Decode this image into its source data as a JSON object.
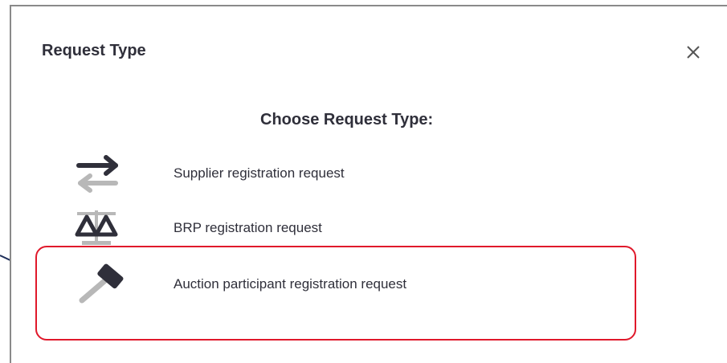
{
  "dialog": {
    "title": "Request Type",
    "close_icon": "close-icon",
    "heading": "Choose Request Type:"
  },
  "options": [
    {
      "label": "Supplier registration request",
      "icon": "swap-arrows-icon"
    },
    {
      "label": "BRP registration request",
      "icon": "balance-scale-icon"
    },
    {
      "label": "Auction participant registration request",
      "icon": "gavel-icon"
    }
  ],
  "colors": {
    "text": "#2f2f3a",
    "icon_dark": "#2f2f3a",
    "icon_light": "#b8b8b8",
    "highlight": "#e0192b",
    "arrow": "#1f2f5a"
  }
}
